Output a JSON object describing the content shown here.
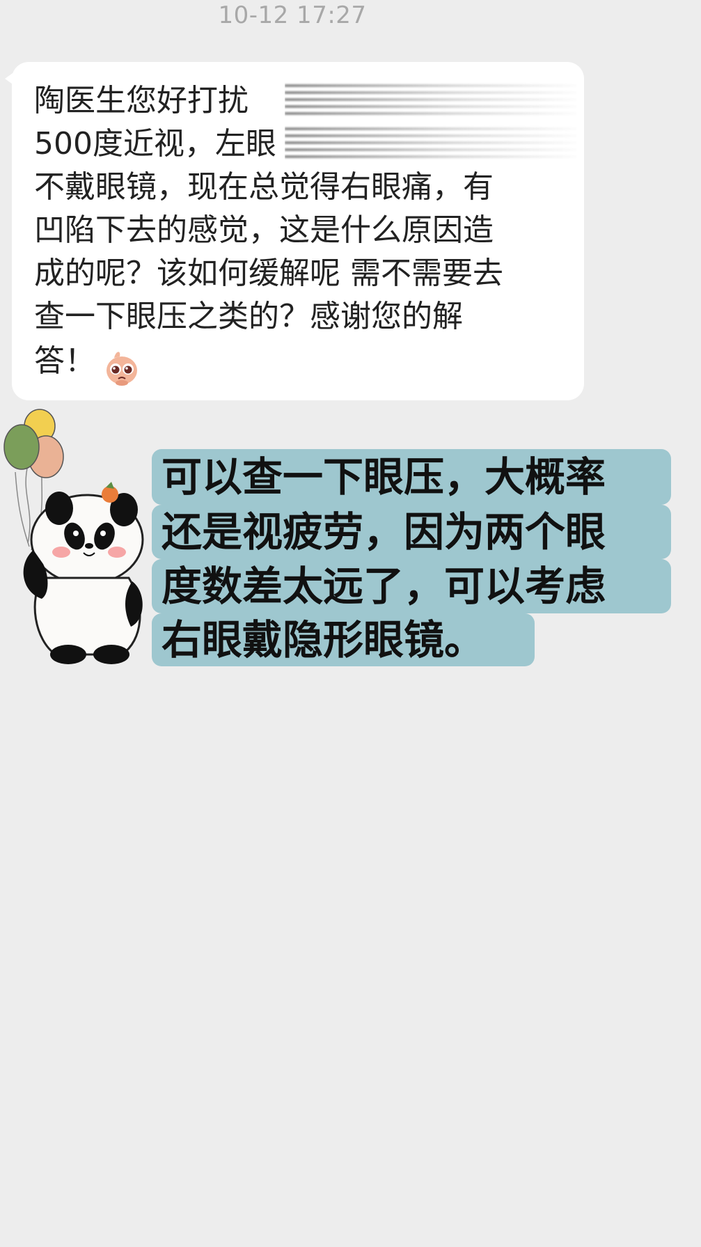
{
  "chat": {
    "timestamp": "10-12 17:27",
    "incoming_message": {
      "lines": [
        "陶医生您好打扰",
        "500度近视，左眼",
        "不戴眼镜，现在总觉得右眼痛，有",
        "凹陷下去的感觉，这是什么原因造",
        "成的呢？该如何缓解呢 需不需要去",
        "查一下眼压之类的？感谢您的解",
        "答！"
      ],
      "emoji_icon": "pleading-face-icon"
    },
    "reply_message": {
      "lines": [
        "可以查一下眼压，大概率",
        "还是视疲劳，因为两个眼",
        "度数差太远了，可以考虑",
        "右眼戴隐形眼镜。"
      ],
      "highlight_color": "#9ec7cf"
    },
    "sticker": {
      "icon": "panda-balloons-sticker-icon"
    }
  },
  "colors": {
    "background": "#ededed",
    "bubble": "#ffffff",
    "timestamp": "#a8a8a8"
  }
}
